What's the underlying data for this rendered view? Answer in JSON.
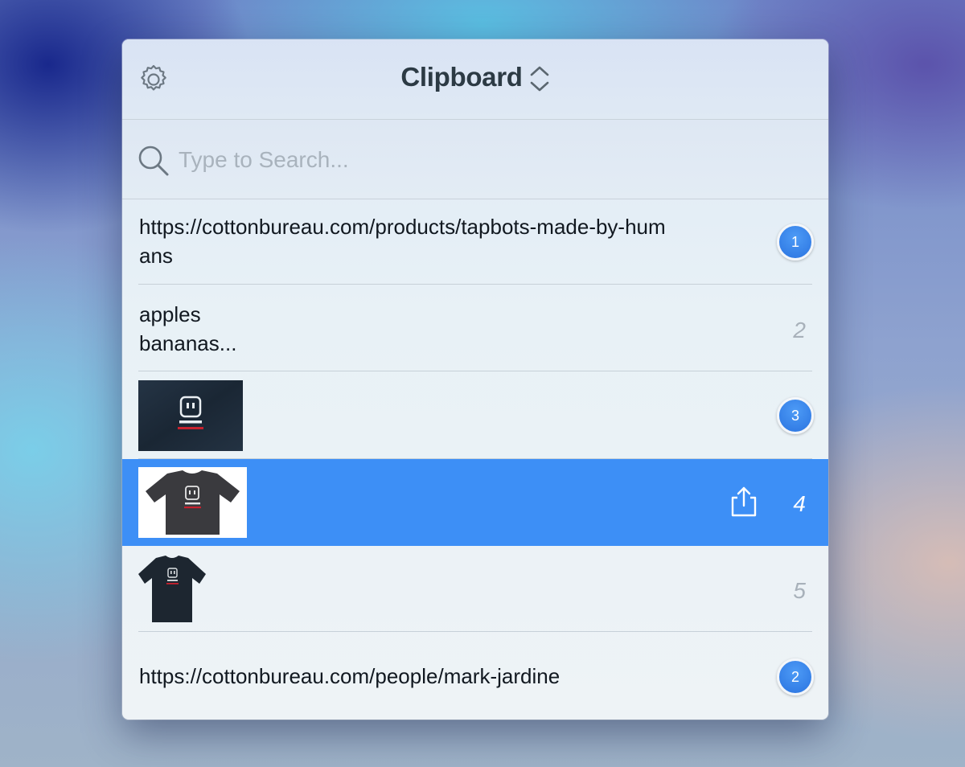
{
  "window": {
    "title": "Clipboard",
    "settings_icon": "gear-icon",
    "switcher_icon": "up-down-chevron-icon"
  },
  "search": {
    "placeholder": "Type to Search...",
    "value": "",
    "icon": "search-icon"
  },
  "items": [
    {
      "type": "text",
      "text": "https://cottonbureau.com/products/tapbots-made-by-hum\nans",
      "shortcut": "1",
      "shortcut_style": "badge"
    },
    {
      "type": "text",
      "text": "apples\nbananas...",
      "shortcut": "2",
      "shortcut_style": "plain"
    },
    {
      "type": "image",
      "thumbnail": "tapbots-logo-fabric-image",
      "shortcut": "3",
      "shortcut_style": "badge"
    },
    {
      "type": "image",
      "thumbnail": "tapbots-tshirt-image",
      "shortcut": "4",
      "shortcut_style": "plain",
      "selected": true,
      "action_icon": "share-icon"
    },
    {
      "type": "image",
      "thumbnail": "tapbots-tshirt-front-image",
      "shortcut": "5",
      "shortcut_style": "plain"
    },
    {
      "type": "text",
      "text": "https://cottonbureau.com/people/mark-jardine",
      "shortcut": "2",
      "shortcut_style": "badge"
    }
  ],
  "colors": {
    "accent": "#3d8ff6",
    "badge": "#2a73e0",
    "text": "#111820",
    "muted": "#a8b1ba"
  }
}
